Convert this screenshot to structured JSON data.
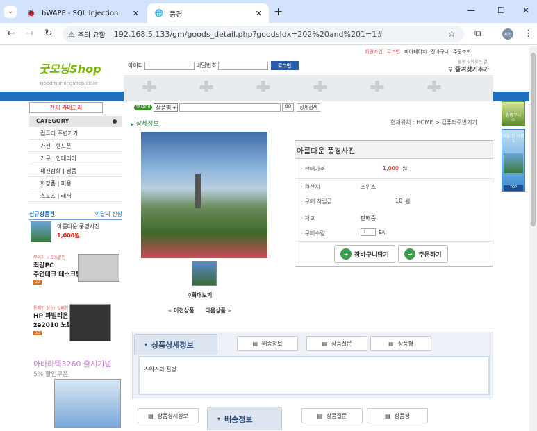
{
  "browser": {
    "tabs": [
      {
        "title": "bWAPP - SQL Injection",
        "active": false
      },
      {
        "title": "풍경",
        "active": true
      }
    ],
    "security_label": "주의 요함",
    "url": "192.168.5.133/gm/goods_detail.php?goodsIdx=202%20and%201=1#",
    "profile_initial": "지한"
  },
  "site": {
    "logo_text": "굿모닝Shop",
    "logo_sub": "goodmorningshop.co.kr",
    "top_links": [
      "회원가입",
      "로그인",
      "마이페이지",
      "장바구니",
      "주문조회"
    ],
    "login": {
      "id_label": "아이디",
      "pw_label": "비밀번호",
      "button": "로그인"
    },
    "bookmark": {
      "small": "쉽게 찾아오는 길",
      "label": "즐겨찾기추가"
    },
    "category_button": "전체 카테고리",
    "category_title": "CATEGORY",
    "categories": [
      "컴퓨터 주변기기",
      "가전 | 핸드폰",
      "가구 | 인테리어",
      "패션잡화 | 명품",
      "화장품 | 미용",
      "스포츠 | 레저"
    ],
    "new_products": {
      "title": "신규상품전",
      "tab2": "이달의 신상",
      "item_name": "아름다운 풍경사진",
      "item_price": "1,000원"
    },
    "ads": [
      {
        "small": "무이자 + 5%할인",
        "line1": "최강PC",
        "line2": "주연테크 데스크탑"
      },
      {
        "small": "통쾌한 성능! 실패한 가격!",
        "line1": "HP 파빌리온",
        "line2": "ze2010 노트북"
      },
      {
        "small": "",
        "line1": "아바라텍3260 출시기념",
        "line2": "5% 할인쿠폰"
      }
    ],
    "ad_go": "GO",
    "search": {
      "badge": "SEARCH",
      "select": "상품명",
      "go": "GO",
      "advanced": "상세검색"
    },
    "page_title": "상세정보",
    "breadcrumb": "현재위치 : HOME > 컴퓨터주변기기",
    "zoom_label": "확대보기",
    "prev_label": "이전상품",
    "next_label": "다음상품",
    "right_side": {
      "cart": "장바구니",
      "cart_count": "0",
      "recent": "오늘 본 상품",
      "recent_count": "1",
      "top": "TOP"
    }
  },
  "product": {
    "name": "아름다운 풍경사진",
    "rows": [
      {
        "label": "판매가격",
        "value": "1,000",
        "unit": "원"
      },
      {
        "label": "원산지",
        "value": "스위스",
        "unit": ""
      },
      {
        "label": "구매 적립금",
        "value": "10",
        "unit": "원"
      },
      {
        "label": "재고",
        "value": "판매중",
        "unit": ""
      },
      {
        "label": "구매수량",
        "value": "1",
        "unit": "EA"
      }
    ],
    "cart_button": "장바구니담기",
    "order_button": "주문하기",
    "tabs": [
      "상품상세정보",
      "배송정보",
      "상품질문",
      "상품평"
    ],
    "detail_text": "스위스의 절경"
  },
  "colors": {
    "accent_blue": "#1d6fc0",
    "price_red": "#d10000",
    "green": "#2a8a3a"
  }
}
